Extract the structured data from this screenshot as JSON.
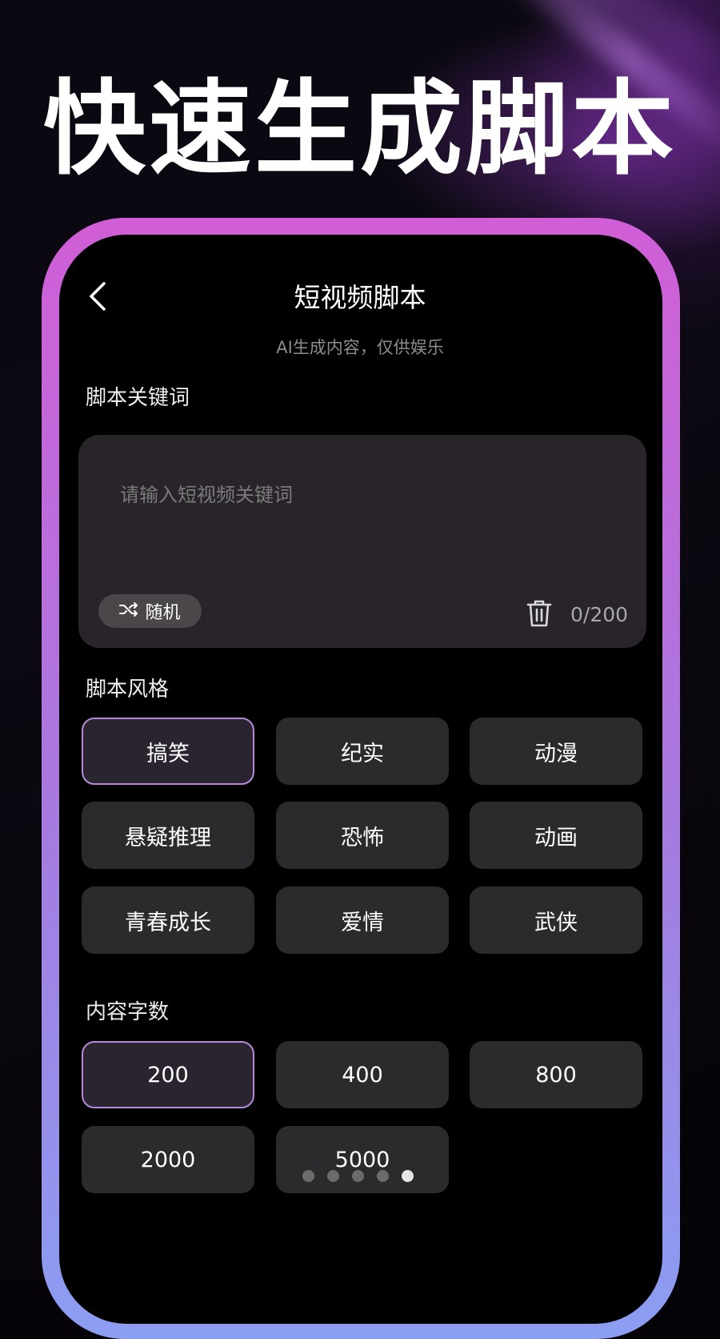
{
  "headline": "快速生成脚本",
  "screen": {
    "title": "短视频脚本",
    "subtitle": "AI生成内容，仅供娱乐"
  },
  "keywords": {
    "label": "脚本关键词",
    "placeholder": "请输入短视频关键词",
    "value": "",
    "random_label": "随机",
    "random_icon": "shuffle-icon",
    "delete_icon": "trash-icon",
    "char_count": "0/200"
  },
  "style": {
    "label": "脚本风格",
    "options": [
      "搞笑",
      "纪实",
      "动漫",
      "悬疑推理",
      "恐怖",
      "动画",
      "青春成长",
      "爱情",
      "武侠"
    ],
    "selected": "搞笑"
  },
  "word_count": {
    "label": "内容字数",
    "options": [
      "200",
      "400",
      "800",
      "2000",
      "5000"
    ],
    "selected": "200"
  },
  "pagination": {
    "total": 5,
    "active_index": 4
  },
  "colors": {
    "frame_top": "#d15ed6",
    "frame_bottom": "#8b9ef2",
    "selected_border": "#b58ad8",
    "chip_bg": "#2b2a2c"
  }
}
